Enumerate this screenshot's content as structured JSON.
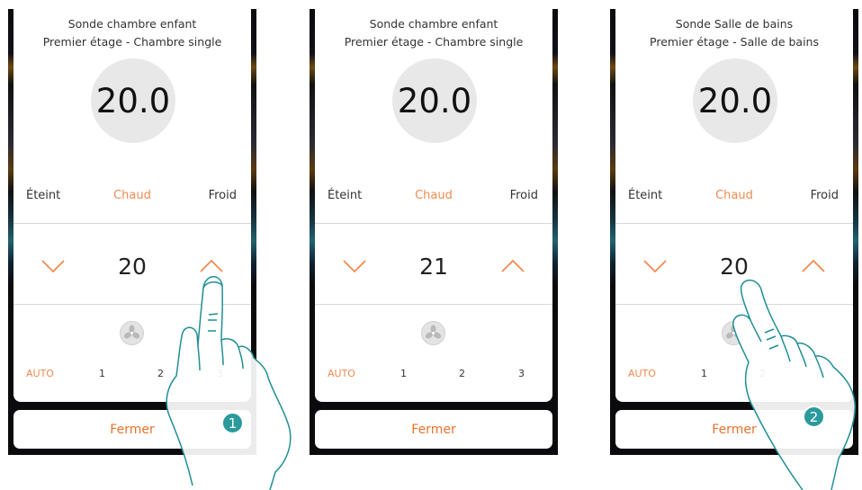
{
  "panels": [
    {
      "title_line1": "Sonde chambre enfant",
      "title_line2": "Premier étage - Chambre single",
      "temperature": "20.0",
      "mode_off": "Éteint",
      "mode_heat": "Chaud",
      "mode_cold": "Froid",
      "setpoint": "20",
      "speed_auto": "AUTO",
      "speed_1": "1",
      "speed_2": "2",
      "speed_3": "3",
      "close_label": "Fermer"
    },
    {
      "title_line1": "Sonde chambre enfant",
      "title_line2": "Premier étage - Chambre single",
      "temperature": "20.0",
      "mode_off": "Éteint",
      "mode_heat": "Chaud",
      "mode_cold": "Froid",
      "setpoint": "21",
      "speed_auto": "AUTO",
      "speed_1": "1",
      "speed_2": "2",
      "speed_3": "3",
      "close_label": "Fermer"
    },
    {
      "title_line1": "Sonde Salle de bains",
      "title_line2": "Premier étage - Salle de bains",
      "temperature": "20.0",
      "mode_off": "Éteint",
      "mode_heat": "Chaud",
      "mode_cold": "Froid",
      "setpoint": "20",
      "speed_auto": "AUTO",
      "speed_1": "1",
      "speed_2": "2",
      "speed_3": "3",
      "close_label": "Fermer"
    }
  ],
  "steps": {
    "step1": "1",
    "step2": "2"
  },
  "colors": {
    "accent": "#f08a50",
    "close_text": "#e8722c",
    "badge": "#2a9a9c",
    "hand_outline": "#1f8f95"
  }
}
